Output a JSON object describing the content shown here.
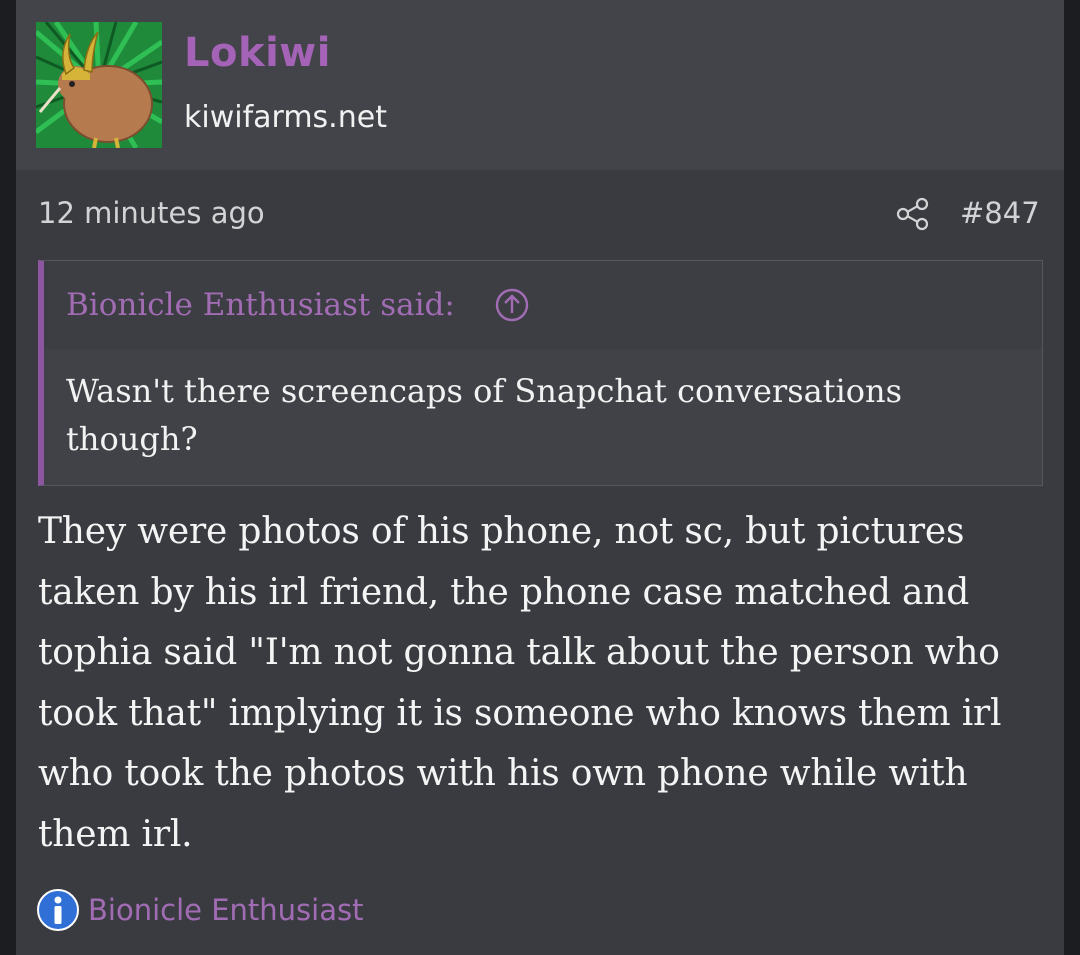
{
  "post": {
    "author": {
      "username": "Lokiwi",
      "site": "kiwifarms.net",
      "avatar_icon": "kiwi-bird-with-loki-helmet-avatar"
    },
    "meta": {
      "time": "12 minutes ago",
      "share_icon": "share-icon",
      "post_number": "#847"
    },
    "quote": {
      "author_label": "Bionicle Enthusiast said:",
      "jump_icon": "arrow-up-circle-icon",
      "text": "Wasn't there screencaps of Snapchat conversations though?"
    },
    "body": "They were photos of his phone, not sc, but pictures taken by his irl friend, the phone case matched and tophia said \"I'm not gonna talk about the person who took that\" implying it is someone who knows them irl who took the photos with his own phone while with them irl.",
    "reactions": {
      "icon": "info-icon",
      "user": "Bionicle Enthusiast"
    }
  },
  "colors": {
    "background": "#393b41",
    "header_background": "#42444a",
    "username": "#a463b6",
    "quote_accent": "#8c56a0",
    "link_purple": "#a26cb4",
    "info_blue": "#2f6fd6"
  }
}
